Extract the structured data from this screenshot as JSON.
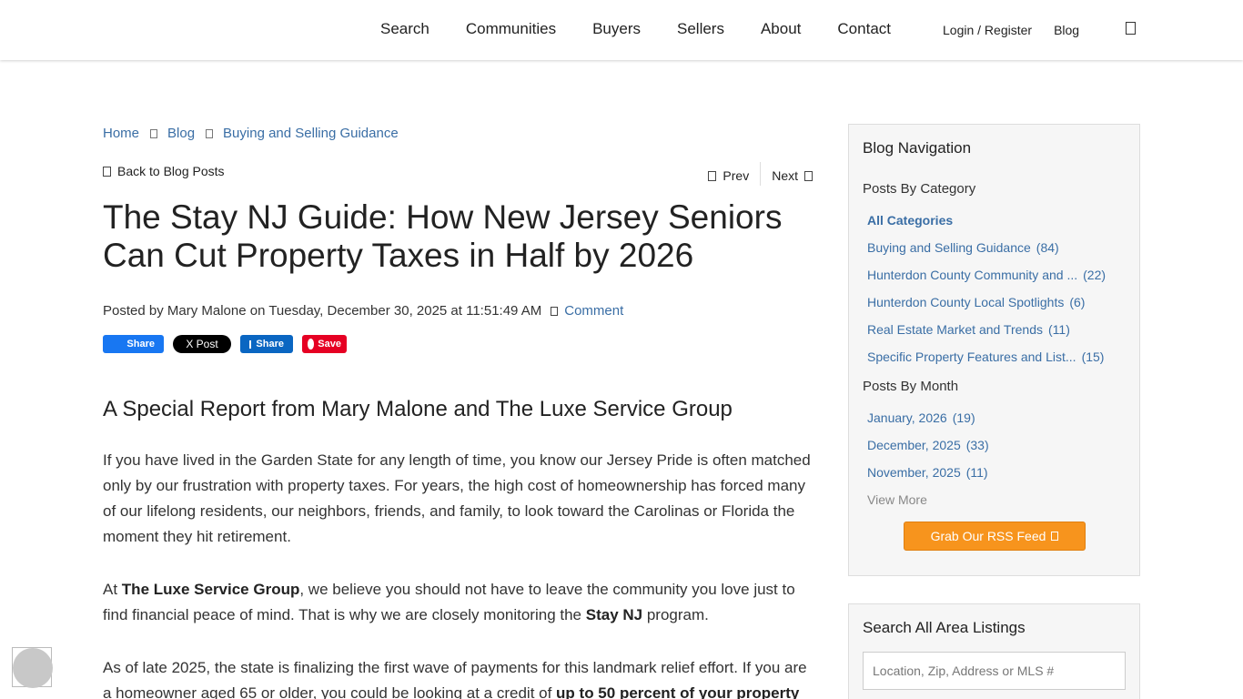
{
  "header": {
    "nav": [
      "Search",
      "Communities",
      "Buyers",
      "Sellers",
      "About",
      "Contact"
    ],
    "util": [
      "Login / Register",
      "Blog"
    ]
  },
  "breadcrumb": [
    "Home",
    "Blog",
    "Buying and Selling Guidance"
  ],
  "post_nav": {
    "back": "Back to Blog Posts",
    "prev": "Prev",
    "next": "Next"
  },
  "post": {
    "title": "The Stay NJ Guide: How New Jersey Seniors Can Cut Property Taxes in Half by 2026",
    "byline": "Posted by Mary Malone on Tuesday, December 30, 2025 at 11:51:49 AM",
    "comment": "Comment",
    "share": {
      "facebook": "Share",
      "x": "X Post",
      "linkedin": "Share",
      "pinterest": "Save"
    },
    "subtitle": "A Special Report from Mary Malone and The Luxe Service Group",
    "p1": "If you have lived in the Garden State for any length of time, you know our Jersey Pride is often matched only by our frustration with property taxes. For years, the high cost of homeownership has forced many of our lifelong residents, our neighbors, friends, and family, to look toward the Carolinas or Florida the moment they hit retirement.",
    "p2_a": "At ",
    "p2_b": "The Luxe Service Group",
    "p2_c": ", we believe you should not have to leave the community you love just to find financial peace of mind. That is why we are closely monitoring the ",
    "p2_d": "Stay NJ",
    "p2_e": " program.",
    "p3_a": "As of late 2025, the state is finalizing the first wave of payments for this landmark relief effort. If you are a homeowner aged 65 or older, you could be looking at a credit of ",
    "p3_b": "up to 50 percent of your property"
  },
  "sidebar": {
    "title": "Blog Navigation",
    "by_category": "Posts By Category",
    "categories": [
      {
        "label": "All Categories",
        "count": ""
      },
      {
        "label": "Buying and Selling Guidance",
        "count": "(84)"
      },
      {
        "label": "Hunterdon County Community and ...",
        "count": "(22)"
      },
      {
        "label": "Hunterdon County Local Spotlights",
        "count": "(6)"
      },
      {
        "label": "Real Estate Market and Trends",
        "count": "(11)"
      },
      {
        "label": "Specific Property Features and List...",
        "count": "(15)"
      }
    ],
    "by_month": "Posts By Month",
    "months": [
      {
        "label": "January, 2026",
        "count": "(19)"
      },
      {
        "label": "December, 2025",
        "count": "(33)"
      },
      {
        "label": "November, 2025",
        "count": "(11)"
      }
    ],
    "view_more": "View More",
    "rss": "Grab Our RSS Feed"
  },
  "search": {
    "title": "Search All Area Listings",
    "placeholder": "Location, Zip, Address or MLS #"
  }
}
